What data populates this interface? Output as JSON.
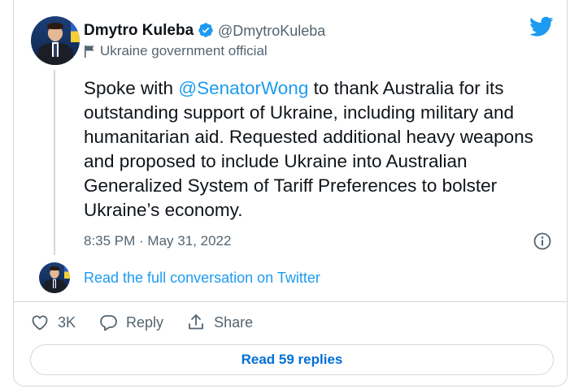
{
  "author": {
    "name": "Dmytro Kuleba",
    "handle": "@DmytroKuleba",
    "label": "Ukraine government official"
  },
  "tweet": {
    "text_before": "Spoke with ",
    "mention": "@SenatorWong",
    "text_after": " to thank Australia for its outstanding support of Ukraine, including military and humanitarian aid. Requested additional heavy weapons and proposed to include Ukraine into Australian Generalized System of Tariff Preferences to bolster Ukraine’s economy.",
    "timestamp": "8:35 PM · May 31, 2022"
  },
  "conversation_link": "Read the full conversation on Twitter",
  "actions": {
    "like_count": "3K",
    "reply_label": "Reply",
    "share_label": "Share"
  },
  "replies_button": "Read 59 replies",
  "colors": {
    "accent": "#1d9bf0",
    "link_dark": "#006fd6",
    "secondary_text": "#536471",
    "border": "#cfd9de"
  },
  "icons": [
    "verified-badge-icon",
    "government-flag-icon",
    "twitter-bird-icon",
    "info-icon",
    "heart-icon",
    "reply-icon",
    "share-icon"
  ]
}
